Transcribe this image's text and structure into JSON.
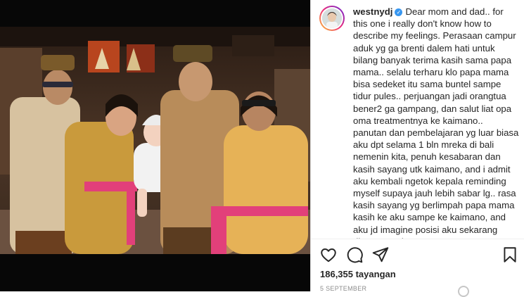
{
  "post": {
    "username": "westnydj",
    "caption": "Dear mom and dad.. for this one i really don't know how to describe my feelings. Perasaan campur aduk yg ga brenti dalem hati untuk bilang banyak terima kasih sama papa mama.. selalu terharu klo papa mama bisa sedeket itu sama buntel sampe tidur pules.. perjuangan jadi orangtua bener2 ga gampang, dan salut liat opa oma treatmentnya ke kaimano.. panutan dan pembelajaran yg luar biasa aku dpt selama 1 bln mreka di bali nemenin kita, penuh kesabaran dan kasih sayang utk kaimano, and i admit aku kembali ngetok kepala reminding myself supaya jauh lebih sabar lg.. rasa kasih sayang yg berlimpah papa mama kasih ke aku sampe ke kaimano, and aku jd imagine posisi aku sekarang dimasa mreka",
    "views": "186,355 tayangan",
    "date": "5 SEPTEMBER"
  },
  "icons": {
    "verified": "verified-badge-icon",
    "like": "heart-icon",
    "comment": "comment-icon",
    "share": "paper-plane-icon",
    "save": "bookmark-icon",
    "loading": "spinner-icon"
  },
  "colors": {
    "verified": "#3897f0",
    "text": "#262626",
    "muted": "#8e8e8e",
    "sash": "#e2407a",
    "kebaya": "#d9a84a"
  }
}
